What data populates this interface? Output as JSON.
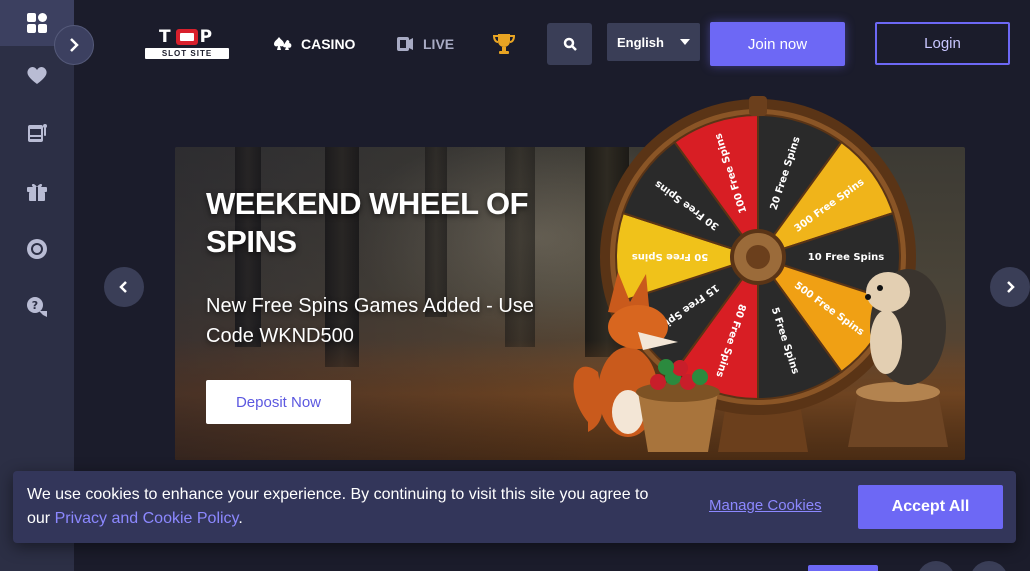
{
  "sidebar": {
    "items": [
      {
        "icon": "dashboard-icon"
      },
      {
        "icon": "heart-icon"
      },
      {
        "icon": "slot-machine-icon"
      },
      {
        "icon": "gift-icon"
      },
      {
        "icon": "chip-icon"
      },
      {
        "icon": "help-chat-icon"
      }
    ],
    "expand_icon": "chevron-right-icon"
  },
  "header": {
    "logo": {
      "top": "TOP",
      "sub": "SLOT SITE"
    },
    "nav": {
      "casino": "CASINO",
      "live": "LIVE"
    },
    "trophy_icon": "trophy-icon",
    "search_icon": "search-icon",
    "language": "English",
    "join_label": "Join now",
    "login_label": "Login"
  },
  "hero": {
    "title": "WEEKEND WHEEL OF SPINS",
    "subtitle": "New Free Spins Games Added - Use Code WKND500",
    "cta": "Deposit Now",
    "wheel_segments": [
      "20 Free Spins",
      "300 Free Spins",
      "10 Free Spins",
      "500 Free Spins",
      "5 Free Spins",
      "80 Free Spins",
      "15 Free Spins",
      "50 Free Spins",
      "30 Free Spins",
      "100 Free Spins"
    ]
  },
  "cookie": {
    "text_before": "We use cookies to enhance your experience. By continuing to visit this site you agree to our ",
    "link": "Privacy and Cookie Policy",
    "text_after": ".",
    "manage": "Manage Cookies",
    "accept": "Accept All"
  },
  "colors": {
    "background": "#1b1c2b",
    "sidebar": "#2c2f45",
    "accent": "#6d68f5",
    "panel": "#3a3e57"
  }
}
